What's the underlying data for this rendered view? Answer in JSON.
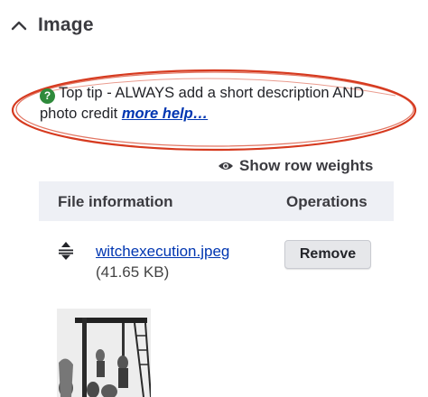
{
  "section": {
    "title": "Image"
  },
  "tip": {
    "text": "Top tip - ALWAYS add a short description AND photo credit",
    "link": "more help…"
  },
  "row_weights": {
    "label": "Show row weights"
  },
  "table": {
    "headers": {
      "file": "File information",
      "operations": "Operations"
    },
    "rows": [
      {
        "filename": "witchexecution.jpeg",
        "size": "(41.65 KB)",
        "action": "Remove"
      }
    ]
  },
  "colors": {
    "link": "#0036b1",
    "tip_icon": "#2f8a3b",
    "annotation_ellipse": "#d63a1f",
    "table_header_bg": "#eef0f5"
  },
  "icons": {
    "section_toggle": "chevron-up-icon",
    "tip": "question-circle-icon",
    "row_weights": "eye-icon",
    "row": "drag-handle-icon"
  }
}
